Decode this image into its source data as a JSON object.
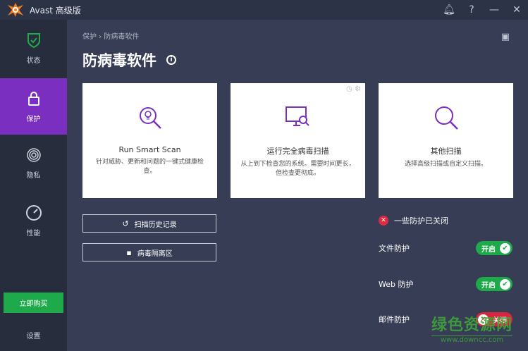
{
  "app": {
    "title": "Avast 高级版"
  },
  "titlebar": {
    "icons": [
      "bell-icon",
      "help-icon",
      "minimize-icon",
      "close-icon"
    ]
  },
  "sidebar": {
    "items": [
      {
        "label": "状态",
        "icon": "shield-check-icon"
      },
      {
        "label": "保护",
        "icon": "lock-icon"
      },
      {
        "label": "隐私",
        "icon": "fingerprint-icon"
      },
      {
        "label": "性能",
        "icon": "speedometer-icon"
      }
    ],
    "buy_label": "立即购买",
    "settings_label": "设置"
  },
  "main": {
    "breadcrumb": "保护 › 防病毒软件",
    "title": "防病毒软件",
    "cards": [
      {
        "title": "Run Smart Scan",
        "desc": "针对威胁、更新和问题的一键式健康检查。"
      },
      {
        "title": "运行完全病毒扫描",
        "desc": "从上到下检查您的系统。需要时间更长，但检查更彻底。"
      },
      {
        "title": "其他扫描",
        "desc": "选择高级扫描或自定义扫描。"
      }
    ],
    "buttons": [
      {
        "label": "扫描历史记录"
      },
      {
        "label": "病毒隔离区"
      }
    ],
    "status": "一些防护已关闭",
    "shields": [
      {
        "label": "文件防护",
        "state": "开启",
        "on": true
      },
      {
        "label": "Web 防护",
        "state": "开启",
        "on": true
      },
      {
        "label": "邮件防护",
        "state": "关闭",
        "on": false
      }
    ]
  },
  "watermark": {
    "name": "绿色资源网",
    "url": "www.downcc.com"
  },
  "colors": {
    "accent": "#7a2fc0",
    "green": "#1ea94b",
    "red": "#d9263f"
  }
}
